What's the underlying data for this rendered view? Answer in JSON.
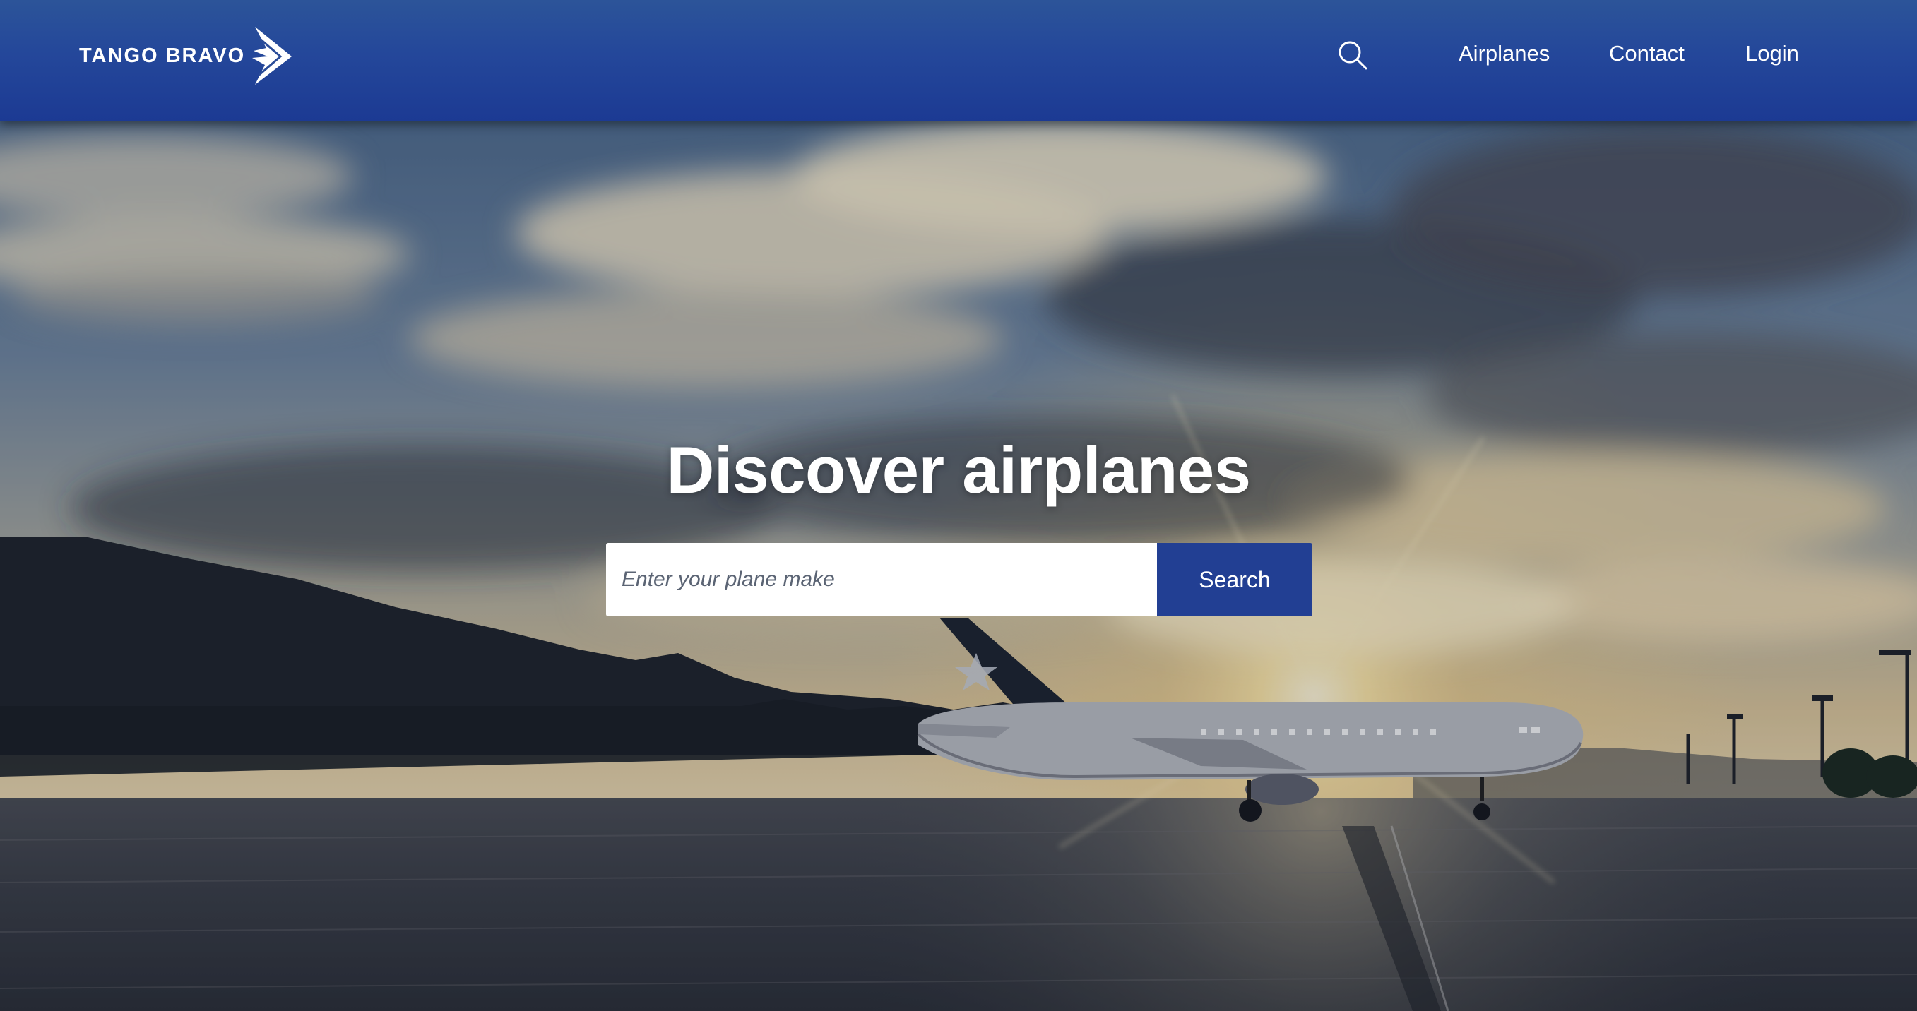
{
  "brand": {
    "name": "TANGO BRAVO",
    "logo_icon": "paper-plane-arrow-icon"
  },
  "header": {
    "search_icon": "search-icon",
    "nav": [
      {
        "label": "Airplanes"
      },
      {
        "label": "Contact"
      },
      {
        "label": "Login"
      }
    ]
  },
  "hero": {
    "title": "Discover airplanes",
    "search_placeholder": "Enter your plane make",
    "search_value": "",
    "search_button": "Search"
  },
  "theme": {
    "header_blue": "#24479a",
    "button_blue": "#223f93",
    "text_light": "#ffffff"
  }
}
